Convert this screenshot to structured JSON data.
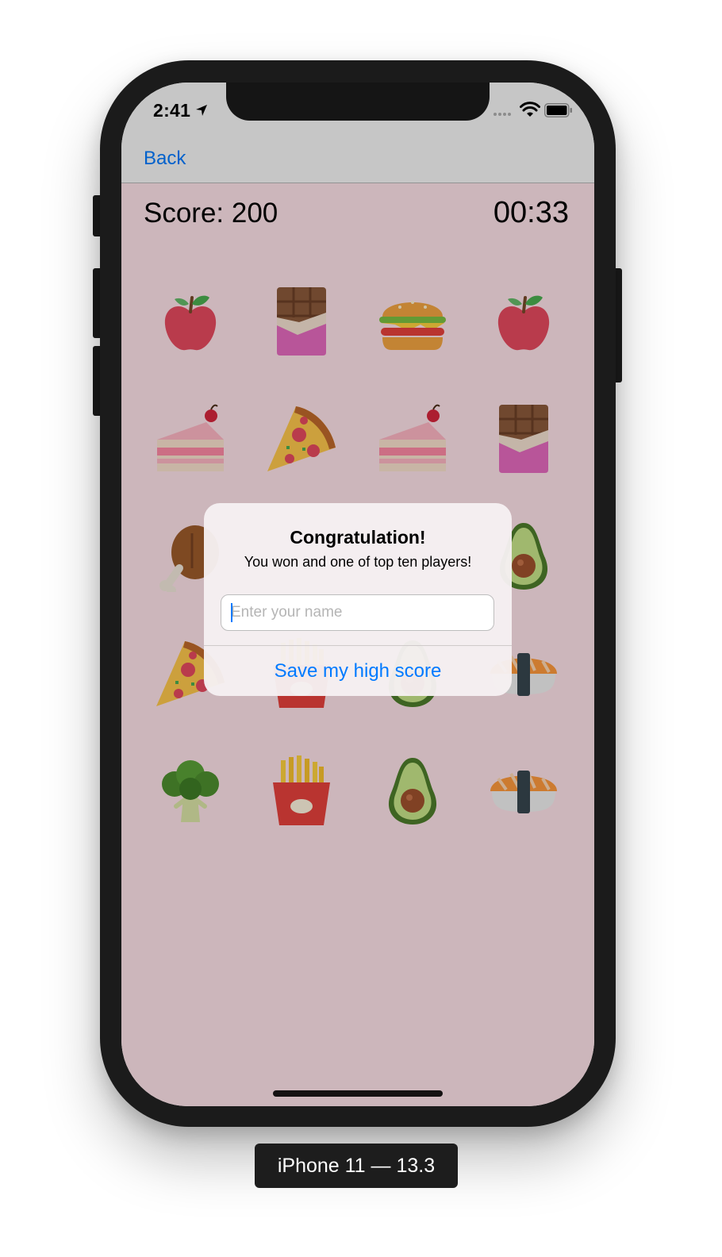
{
  "status_bar": {
    "time": "2:41",
    "icons": [
      "location-arrow-icon",
      "signal-icon",
      "wifi-icon",
      "battery-icon"
    ]
  },
  "nav": {
    "back_label": "Back"
  },
  "game": {
    "score": "Score: 200",
    "timer": "00:33",
    "cards": [
      [
        "apple",
        "chocolate",
        "burger",
        "apple"
      ],
      [
        "cake",
        "pizza",
        "cake",
        "chocolate"
      ],
      [
        "drumstick",
        "hidden",
        "hidden",
        "avocado"
      ],
      [
        "pizza",
        "fries",
        "avocado",
        "sushi"
      ],
      [
        "broccoli",
        "fries",
        "avocado",
        "sushi"
      ]
    ]
  },
  "alert": {
    "title": "Congratulation!",
    "message": "You won and one of top ten players!",
    "input_placeholder": "Enter your name",
    "input_value": "",
    "button_label": "Save my high score"
  },
  "device_label": "iPhone 11 — 13.3",
  "colors": {
    "accent": "#007aff",
    "game_background": "#ffe4ea",
    "dim_overlay": "rgba(0,0,0,0.20)"
  }
}
